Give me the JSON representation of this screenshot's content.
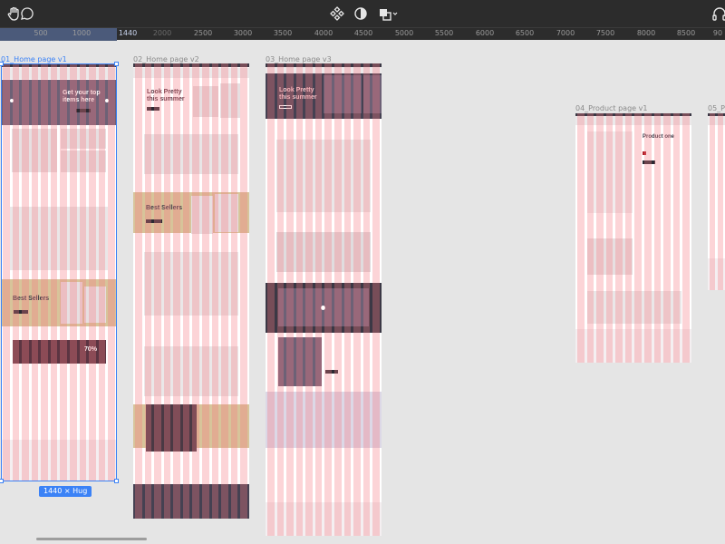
{
  "toolbar": {
    "icons": [
      "hand-icon",
      "comment-icon",
      "component-icon",
      "contrast-icon",
      "boolean-icon",
      "headphones-icon"
    ]
  },
  "ruler": {
    "ticks": [
      "500",
      "1000",
      "1440",
      "2000",
      "2500",
      "3000",
      "3500",
      "4000",
      "4500",
      "5000",
      "5500",
      "6000",
      "6500",
      "7000",
      "7500",
      "8000",
      "8500",
      "90"
    ]
  },
  "frames": [
    {
      "label": "01_Home page v1"
    },
    {
      "label": "02_Home page v2"
    },
    {
      "label": "03_Home page v3"
    },
    {
      "label": "04_Product page v1"
    },
    {
      "label": "05_Pr"
    }
  ],
  "selection": {
    "size_badge": "1440 × Hug"
  },
  "frame_text": {
    "f1_hero": "Get your top items here",
    "f1_best": "Best Sellers",
    "f1_percent": "70%",
    "f2_hero": "Look Pretty this summer",
    "f2_best": "Best Sellers",
    "f3_hero": "Look Pretty this summer",
    "f4_product": "Product one"
  },
  "colors": {
    "selection": "#3b82f6",
    "canvas": "#e5e5e5",
    "toolbar": "#2c2c2c",
    "column_overlay": "#f77882"
  }
}
